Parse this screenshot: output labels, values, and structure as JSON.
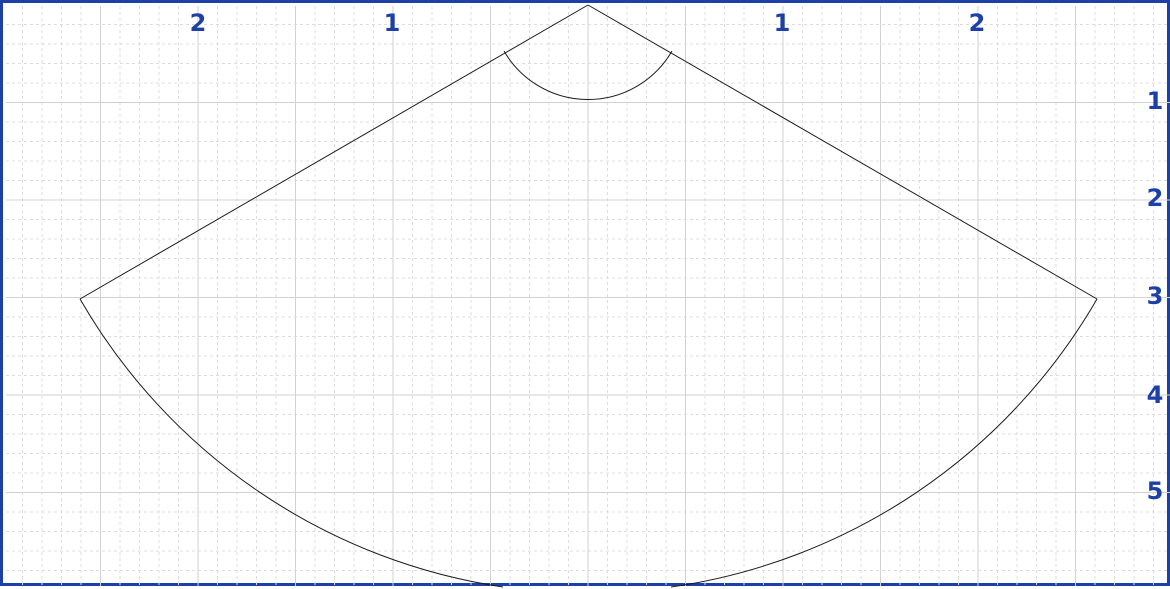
{
  "diagram": {
    "top_labels": [
      "2",
      "1",
      "1",
      "2"
    ],
    "right_labels": [
      "1",
      "2",
      "3",
      "4",
      "5"
    ],
    "colors": {
      "frame": "#1c3fa8",
      "labels": "#1c3fa8",
      "outline": "#1a1a1a",
      "grid": "#d2d2d2"
    }
  }
}
